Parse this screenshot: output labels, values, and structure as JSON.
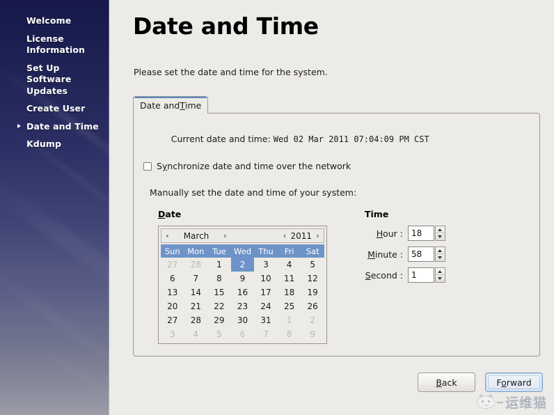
{
  "sidebar": {
    "items": [
      {
        "label": "Welcome",
        "active": false
      },
      {
        "label": "License Information",
        "active": false
      },
      {
        "label": "Set Up Software Updates",
        "active": false
      },
      {
        "label": "Create User",
        "active": false
      },
      {
        "label": "Date and Time",
        "active": true
      },
      {
        "label": "Kdump",
        "active": false
      }
    ],
    "gradient_top": "#16194a",
    "gradient_bottom": "#9b9ca6"
  },
  "page": {
    "title": "Date and Time",
    "description": "Please set the date and time for the system."
  },
  "tabs": [
    {
      "label_pre": "Date and ",
      "label_mnem": "T",
      "label_post": "ime",
      "active": true
    }
  ],
  "panel": {
    "current_label": "Current date and time: ",
    "current_value": "Wed 02 Mar 2011 07:04:09 PM CST",
    "sync_checkbox": {
      "label_pre": "S",
      "label_mnem": "y",
      "label_post": "nchronize date and time over the network",
      "checked": false
    },
    "manual_line": "Manually set the date and time of your system:"
  },
  "date_section": {
    "heading_mnem": "D",
    "heading_post": "ate",
    "prev_month_icon": "chevron-left-icon",
    "next_month_icon": "chevron-right-icon",
    "prev_year_icon": "chevron-left-icon",
    "next_year_icon": "chevron-right-icon",
    "prev_arrow": "‹",
    "next_arrow": "›",
    "month": "March",
    "year": "2011",
    "day_headers": [
      "Sun",
      "Mon",
      "Tue",
      "Wed",
      "Thu",
      "Fri",
      "Sat"
    ],
    "selected_day": 2,
    "header_color": "#6e93c8",
    "weeks": [
      [
        {
          "d": "27",
          "dim": true
        },
        {
          "d": "28",
          "dim": true
        },
        {
          "d": "1",
          "dim": false
        },
        {
          "d": "2",
          "dim": false,
          "sel": true
        },
        {
          "d": "3",
          "dim": false
        },
        {
          "d": "4",
          "dim": false
        },
        {
          "d": "5",
          "dim": false
        }
      ],
      [
        {
          "d": "6",
          "dim": false
        },
        {
          "d": "7",
          "dim": false
        },
        {
          "d": "8",
          "dim": false
        },
        {
          "d": "9",
          "dim": false
        },
        {
          "d": "10",
          "dim": false
        },
        {
          "d": "11",
          "dim": false
        },
        {
          "d": "12",
          "dim": false
        }
      ],
      [
        {
          "d": "13",
          "dim": false
        },
        {
          "d": "14",
          "dim": false
        },
        {
          "d": "15",
          "dim": false
        },
        {
          "d": "16",
          "dim": false
        },
        {
          "d": "17",
          "dim": false
        },
        {
          "d": "18",
          "dim": false
        },
        {
          "d": "19",
          "dim": false
        }
      ],
      [
        {
          "d": "20",
          "dim": false
        },
        {
          "d": "21",
          "dim": false
        },
        {
          "d": "22",
          "dim": false
        },
        {
          "d": "23",
          "dim": false
        },
        {
          "d": "24",
          "dim": false
        },
        {
          "d": "25",
          "dim": false
        },
        {
          "d": "26",
          "dim": false
        }
      ],
      [
        {
          "d": "27",
          "dim": false
        },
        {
          "d": "28",
          "dim": false
        },
        {
          "d": "29",
          "dim": false
        },
        {
          "d": "30",
          "dim": false
        },
        {
          "d": "31",
          "dim": false
        },
        {
          "d": "1",
          "dim": true
        },
        {
          "d": "2",
          "dim": true
        }
      ],
      [
        {
          "d": "3",
          "dim": true
        },
        {
          "d": "4",
          "dim": true
        },
        {
          "d": "5",
          "dim": true
        },
        {
          "d": "6",
          "dim": true
        },
        {
          "d": "7",
          "dim": true
        },
        {
          "d": "8",
          "dim": true
        },
        {
          "d": "9",
          "dim": true
        }
      ]
    ]
  },
  "time_section": {
    "heading": "Time",
    "fields": [
      {
        "label_mnem": "H",
        "label_post": "our :",
        "value": "18"
      },
      {
        "label_mnem": "M",
        "label_post": "inute :",
        "value": "58"
      },
      {
        "label_mnem": "S",
        "label_post": "econd :",
        "value": "1"
      }
    ],
    "up_icon": "chevron-up-icon",
    "down_icon": "chevron-down-icon"
  },
  "footer": {
    "back": {
      "label_mnem": "B",
      "label_post": "ack",
      "focused": false
    },
    "forward": {
      "label_pre": "F",
      "label_mnem": "o",
      "label_post": "rward",
      "focused": true
    },
    "focus_color": "#7fa4cf"
  },
  "watermark": {
    "text": "运维猫",
    "icon": "cat-face-icon"
  }
}
